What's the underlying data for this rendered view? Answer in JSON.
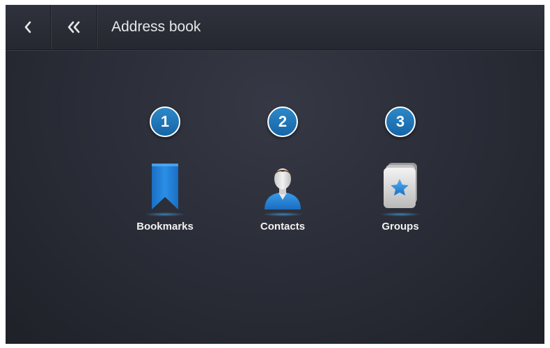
{
  "header": {
    "title": "Address book",
    "back_icon": "chevron-left-icon",
    "home_icon": "double-chevron-left-icon"
  },
  "tiles": [
    {
      "number": "1",
      "label": "Bookmarks",
      "icon": "bookmark-icon"
    },
    {
      "number": "2",
      "label": "Contacts",
      "icon": "person-icon"
    },
    {
      "number": "3",
      "label": "Groups",
      "icon": "star-stack-icon"
    }
  ],
  "colors": {
    "accent": "#1e78bd",
    "background": "#2b2e38",
    "text": "#f2f2f2"
  }
}
